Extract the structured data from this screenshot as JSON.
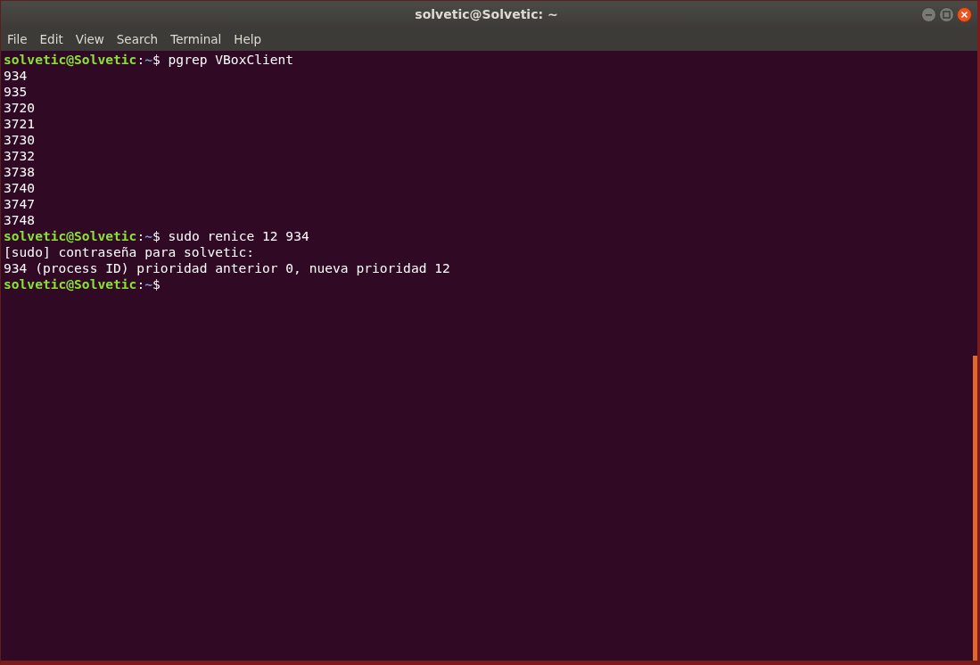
{
  "window": {
    "title": "solvetic@Solvetic: ~"
  },
  "menu": [
    "File",
    "Edit",
    "View",
    "Search",
    "Terminal",
    "Help"
  ],
  "terminal": {
    "lines": [
      {
        "kind": "prompt",
        "user": "solvetic@Solvetic",
        "separator": ":",
        "path": "~",
        "symbol": "$",
        "command": "pgrep VBoxClient"
      },
      {
        "kind": "output",
        "text": "934"
      },
      {
        "kind": "output",
        "text": "935"
      },
      {
        "kind": "output",
        "text": "3720"
      },
      {
        "kind": "output",
        "text": "3721"
      },
      {
        "kind": "output",
        "text": "3730"
      },
      {
        "kind": "output",
        "text": "3732"
      },
      {
        "kind": "output",
        "text": "3738"
      },
      {
        "kind": "output",
        "text": "3740"
      },
      {
        "kind": "output",
        "text": "3747"
      },
      {
        "kind": "output",
        "text": "3748"
      },
      {
        "kind": "prompt",
        "user": "solvetic@Solvetic",
        "separator": ":",
        "path": "~",
        "symbol": "$",
        "command": "sudo renice 12 934"
      },
      {
        "kind": "output",
        "text": "[sudo] contraseña para solvetic:"
      },
      {
        "kind": "output",
        "text": "934 (process ID) prioridad anterior 0, nueva prioridad 12"
      },
      {
        "kind": "prompt",
        "user": "solvetic@Solvetic",
        "separator": ":",
        "path": "~",
        "symbol": "$"
      }
    ]
  }
}
